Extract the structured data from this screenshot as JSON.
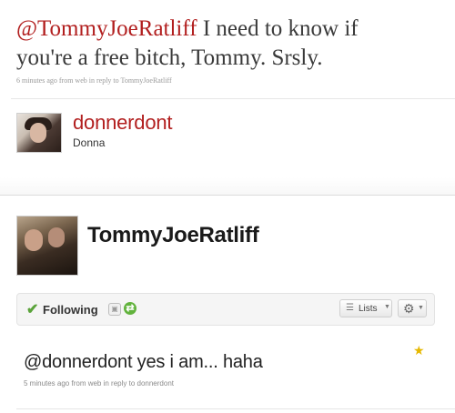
{
  "top_tweet": {
    "mention": "@TommyJoeRatliff",
    "text": " I need to know if you're a free bitch, Tommy. Srsly.",
    "meta": "6 minutes ago from web in reply to TommyJoeRatliff"
  },
  "author": {
    "handle": "donnerdont",
    "name": "Donna"
  },
  "profile": {
    "name": "TommyJoeRatliff",
    "following_label": "Following",
    "lists_label": "Lists"
  },
  "reply_tweet": {
    "text": "@donnerdont yes i am... haha",
    "meta": "5 minutes ago from web in reply to donnerdont"
  },
  "colors": {
    "mention": "#b21f1f",
    "follow_check": "#5aa33a",
    "favorite_star": "#e6b800"
  },
  "icons": [
    "check-icon",
    "device-icon",
    "retweet-icon",
    "list-icon",
    "gear-icon",
    "star-icon"
  ]
}
